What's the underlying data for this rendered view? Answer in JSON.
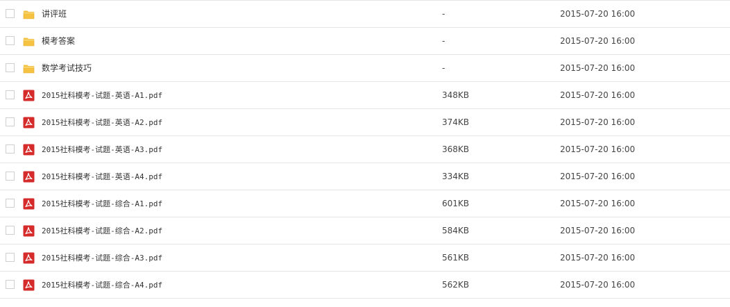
{
  "file_list": {
    "rows": [
      {
        "type": "folder",
        "icon": "folder-icon",
        "name": "讲评班",
        "size": "-",
        "date": "2015-07-20 16:00"
      },
      {
        "type": "folder",
        "icon": "folder-icon",
        "name": "模考答案",
        "size": "-",
        "date": "2015-07-20 16:00"
      },
      {
        "type": "folder",
        "icon": "folder-icon",
        "name": "数学考试技巧",
        "size": "-",
        "date": "2015-07-20 16:00"
      },
      {
        "type": "pdf",
        "icon": "pdf-icon",
        "name": "2015社科模考-试题-英语-A1.pdf",
        "size": "348KB",
        "date": "2015-07-20 16:00"
      },
      {
        "type": "pdf",
        "icon": "pdf-icon",
        "name": "2015社科模考-试题-英语-A2.pdf",
        "size": "374KB",
        "date": "2015-07-20 16:00"
      },
      {
        "type": "pdf",
        "icon": "pdf-icon",
        "name": "2015社科模考-试题-英语-A3.pdf",
        "size": "368KB",
        "date": "2015-07-20 16:00"
      },
      {
        "type": "pdf",
        "icon": "pdf-icon",
        "name": "2015社科模考-试题-英语-A4.pdf",
        "size": "334KB",
        "date": "2015-07-20 16:00"
      },
      {
        "type": "pdf",
        "icon": "pdf-icon",
        "name": "2015社科模考-试题-综合-A1.pdf",
        "size": "601KB",
        "date": "2015-07-20 16:00"
      },
      {
        "type": "pdf",
        "icon": "pdf-icon",
        "name": "2015社科模考-试题-综合-A2.pdf",
        "size": "584KB",
        "date": "2015-07-20 16:00"
      },
      {
        "type": "pdf",
        "icon": "pdf-icon",
        "name": "2015社科模考-试题-综合-A3.pdf",
        "size": "561KB",
        "date": "2015-07-20 16:00"
      },
      {
        "type": "pdf",
        "icon": "pdf-icon",
        "name": "2015社科模考-试题-综合-A4.pdf",
        "size": "562KB",
        "date": "2015-07-20 16:00"
      }
    ]
  },
  "colors": {
    "folder": "#f5c242",
    "folder_dark": "#e0a82a",
    "pdf": "#d62b2b",
    "divider": "#e5e5e5"
  }
}
